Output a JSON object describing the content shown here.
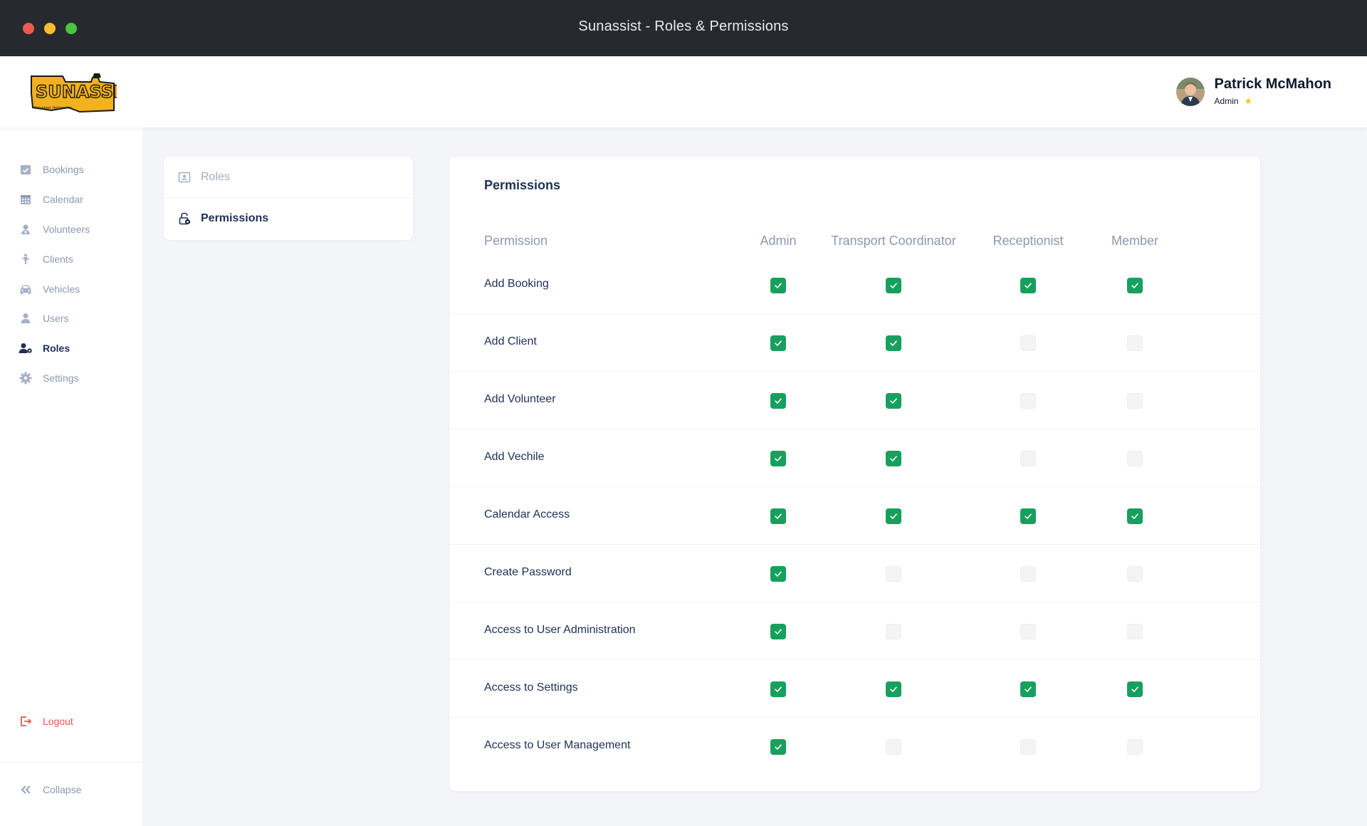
{
  "window": {
    "title": "Sunassist - Roles & Permissions"
  },
  "header": {
    "logo_text": "SUNASSIST",
    "logo_subtext": "Volunteer Helpers Inc.",
    "user": {
      "name": "Patrick McMahon",
      "role": "Admin"
    }
  },
  "sidebar": {
    "items": [
      {
        "label": "Bookings",
        "icon": "calendar-check-icon",
        "active": false
      },
      {
        "label": "Calendar",
        "icon": "calendar-grid-icon",
        "active": false
      },
      {
        "label": "Volunteers",
        "icon": "volunteer-icon",
        "active": false
      },
      {
        "label": "Clients",
        "icon": "walking-person-icon",
        "active": false
      },
      {
        "label": "Vehicles",
        "icon": "car-icon",
        "active": false
      },
      {
        "label": "Users",
        "icon": "user-icon",
        "active": false
      },
      {
        "label": "Roles",
        "icon": "user-gear-icon",
        "active": true
      },
      {
        "label": "Settings",
        "icon": "gear-icon",
        "active": false
      }
    ],
    "logout_label": "Logout",
    "collapse_label": "Collapse"
  },
  "subnav": {
    "items": [
      {
        "label": "Roles",
        "icon": "id-card-icon",
        "active": false
      },
      {
        "label": "Permissions",
        "icon": "lock-icon",
        "active": true
      }
    ]
  },
  "permissions": {
    "title": "Permissions",
    "column_permission": "Permission",
    "roles": [
      "Admin",
      "Transport Coordinator",
      "Receptionist",
      "Member"
    ],
    "rows": [
      {
        "name": "Add Booking",
        "values": [
          true,
          true,
          true,
          true
        ]
      },
      {
        "name": "Add Client",
        "values": [
          true,
          true,
          false,
          false
        ]
      },
      {
        "name": "Add Volunteer",
        "values": [
          true,
          true,
          false,
          false
        ]
      },
      {
        "name": "Add Vechile",
        "values": [
          true,
          true,
          false,
          false
        ]
      },
      {
        "name": "Calendar Access",
        "values": [
          true,
          true,
          true,
          true
        ]
      },
      {
        "name": "Create Password",
        "values": [
          true,
          false,
          false,
          false
        ]
      },
      {
        "name": "Access to User Administration",
        "values": [
          true,
          false,
          false,
          false
        ]
      },
      {
        "name": "Access to Settings",
        "values": [
          true,
          true,
          true,
          true
        ]
      },
      {
        "name": "Access to User Management",
        "values": [
          true,
          false,
          false,
          false
        ]
      }
    ]
  },
  "colors": {
    "check_on": "#17a05d",
    "accent_text": "#1f2f56",
    "muted_text": "#8c97b2",
    "logout": "#f05252",
    "star": "#f5c518"
  }
}
